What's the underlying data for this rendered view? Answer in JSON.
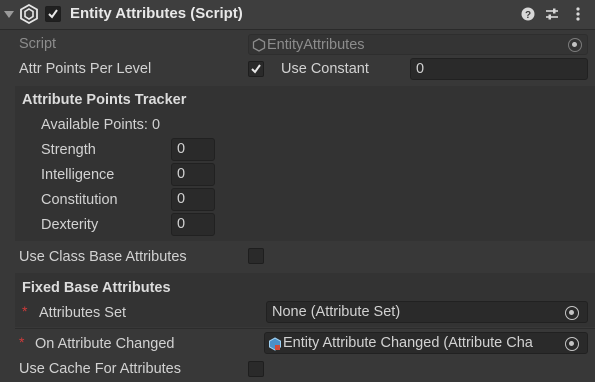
{
  "header": {
    "title": "Entity Attributes (Script)",
    "enabled": true,
    "icons": [
      "foldout-arrow-icon",
      "script-component-icon",
      "help-icon",
      "presets-icon",
      "kebab-menu-icon"
    ]
  },
  "script": {
    "label": "Script",
    "value": "EntityAttributes"
  },
  "attr_points": {
    "label": "Attr Points Per Level",
    "use_constant_checked": true,
    "use_constant_label": "Use Constant",
    "value": "0"
  },
  "tracker": {
    "title": "Attribute Points Tracker",
    "available_points": "Available Points: 0",
    "rows": [
      {
        "label": "Strength",
        "value": "0"
      },
      {
        "label": "Intelligence",
        "value": "0"
      },
      {
        "label": "Constitution",
        "value": "0"
      },
      {
        "label": "Dexterity",
        "value": "0"
      }
    ]
  },
  "use_class_base": {
    "label": "Use Class Base Attributes",
    "checked": false
  },
  "fixed": {
    "title": "Fixed Base Attributes",
    "attributes_set_label": "Attributes Set",
    "attributes_set_value": "None (Attribute Set)",
    "required_marker": "*"
  },
  "on_changed": {
    "label": "On Attribute Changed",
    "value": "Entity Attribute Changed (Attribute Cha",
    "required_marker": "*"
  },
  "use_cache": {
    "label": "Use Cache For Attributes",
    "checked": false
  },
  "colors": {
    "background": "#383838",
    "header": "#3e3e3e",
    "field": "#2a2a2a",
    "required": "#d03a3a"
  }
}
